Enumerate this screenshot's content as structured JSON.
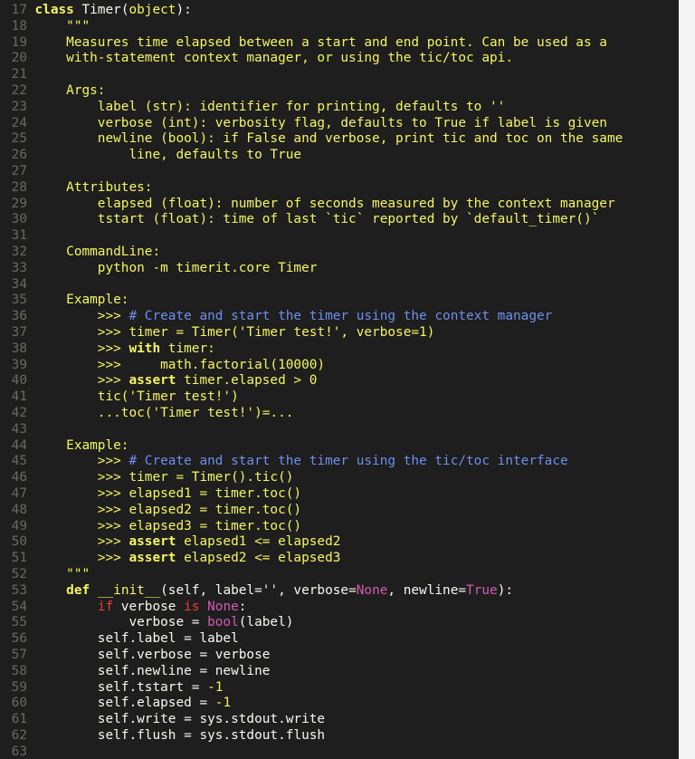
{
  "editor": {
    "lines": [
      {
        "n": "17",
        "tokens": [
          [
            "class ",
            "kw"
          ],
          [
            "Timer",
            "plain"
          ],
          [
            "(",
            "plain"
          ],
          [
            "object",
            "str"
          ],
          [
            "):",
            "plain"
          ]
        ]
      },
      {
        "n": "18",
        "tokens": [
          [
            "    \"\"\"",
            "str"
          ]
        ]
      },
      {
        "n": "19",
        "tokens": [
          [
            "    Measures time elapsed between a start and end point. Can be used as a",
            "str"
          ]
        ]
      },
      {
        "n": "20",
        "tokens": [
          [
            "    with-statement context manager, or using the tic/toc api.",
            "str"
          ]
        ]
      },
      {
        "n": "21",
        "tokens": []
      },
      {
        "n": "22",
        "tokens": [
          [
            "    Args:",
            "str"
          ]
        ]
      },
      {
        "n": "23",
        "tokens": [
          [
            "        label (str): identifier for printing, defaults to ''",
            "str"
          ]
        ]
      },
      {
        "n": "24",
        "tokens": [
          [
            "        verbose (int): verbosity flag, defaults to True if label is given",
            "str"
          ]
        ]
      },
      {
        "n": "25",
        "tokens": [
          [
            "        newline (bool): if False and verbose, print tic and toc on the same",
            "str"
          ]
        ]
      },
      {
        "n": "26",
        "tokens": [
          [
            "            line, defaults to True",
            "str"
          ]
        ]
      },
      {
        "n": "27",
        "tokens": []
      },
      {
        "n": "28",
        "tokens": [
          [
            "    Attributes:",
            "str"
          ]
        ]
      },
      {
        "n": "29",
        "tokens": [
          [
            "        elapsed (float): number of seconds measured by the context manager",
            "str"
          ]
        ]
      },
      {
        "n": "30",
        "tokens": [
          [
            "        tstart (float): time of last `tic` reported by `default_timer()`",
            "str"
          ]
        ]
      },
      {
        "n": "31",
        "tokens": []
      },
      {
        "n": "32",
        "tokens": [
          [
            "    CommandLine:",
            "str"
          ]
        ]
      },
      {
        "n": "33",
        "tokens": [
          [
            "        python -m timerit.core Timer",
            "str"
          ]
        ]
      },
      {
        "n": "34",
        "tokens": []
      },
      {
        "n": "35",
        "tokens": [
          [
            "    Example:",
            "str"
          ]
        ]
      },
      {
        "n": "36",
        "tokens": [
          [
            "        >>> ",
            "str"
          ],
          [
            "# Create and start the timer using the context manager",
            "cmt"
          ]
        ]
      },
      {
        "n": "37",
        "tokens": [
          [
            "        >>> timer = Timer('Timer test!', verbose=1)",
            "str"
          ]
        ]
      },
      {
        "n": "38",
        "tokens": [
          [
            "        >>> ",
            "str"
          ],
          [
            "with",
            "kw"
          ],
          [
            " timer:",
            "str"
          ]
        ]
      },
      {
        "n": "39",
        "tokens": [
          [
            "        >>>     math.factorial(10000)",
            "str"
          ]
        ]
      },
      {
        "n": "40",
        "tokens": [
          [
            "        >>> ",
            "str"
          ],
          [
            "assert",
            "kw"
          ],
          [
            " timer.elapsed > 0",
            "str"
          ]
        ]
      },
      {
        "n": "41",
        "tokens": [
          [
            "        tic('Timer test!')",
            "str"
          ]
        ]
      },
      {
        "n": "42",
        "tokens": [
          [
            "        ...toc('Timer test!')=...",
            "str"
          ]
        ]
      },
      {
        "n": "43",
        "tokens": []
      },
      {
        "n": "44",
        "tokens": [
          [
            "    Example:",
            "str"
          ]
        ]
      },
      {
        "n": "45",
        "tokens": [
          [
            "        >>> ",
            "str"
          ],
          [
            "# Create and start the timer using the tic/toc interface",
            "cmt"
          ]
        ]
      },
      {
        "n": "46",
        "tokens": [
          [
            "        >>> timer = Timer().tic()",
            "str"
          ]
        ]
      },
      {
        "n": "47",
        "tokens": [
          [
            "        >>> elapsed1 = timer.toc()",
            "str"
          ]
        ]
      },
      {
        "n": "48",
        "tokens": [
          [
            "        >>> elapsed2 = timer.toc()",
            "str"
          ]
        ]
      },
      {
        "n": "49",
        "tokens": [
          [
            "        >>> elapsed3 = timer.toc()",
            "str"
          ]
        ]
      },
      {
        "n": "50",
        "tokens": [
          [
            "        >>> ",
            "str"
          ],
          [
            "assert",
            "kw"
          ],
          [
            " elapsed1 <= elapsed2",
            "str"
          ]
        ]
      },
      {
        "n": "51",
        "tokens": [
          [
            "        >>> ",
            "str"
          ],
          [
            "assert",
            "kw"
          ],
          [
            " elapsed2 <= elapsed3",
            "str"
          ]
        ]
      },
      {
        "n": "52",
        "tokens": [
          [
            "    \"\"\"",
            "str"
          ]
        ]
      },
      {
        "n": "53",
        "tokens": [
          [
            "    ",
            "plain"
          ],
          [
            "def",
            "kw"
          ],
          [
            " ",
            "plain"
          ],
          [
            "__init__",
            "str"
          ],
          [
            "(self, label='', verbose=",
            "plain"
          ],
          [
            "None",
            "prm"
          ],
          [
            ", newline=",
            "plain"
          ],
          [
            "True",
            "prm"
          ],
          [
            "):",
            "plain"
          ]
        ]
      },
      {
        "n": "54",
        "tokens": [
          [
            "        ",
            "plain"
          ],
          [
            "if",
            "flow"
          ],
          [
            " verbose ",
            "plain"
          ],
          [
            "is",
            "flow"
          ],
          [
            " ",
            "plain"
          ],
          [
            "None",
            "prm"
          ],
          [
            ":",
            "plain"
          ]
        ]
      },
      {
        "n": "55",
        "tokens": [
          [
            "            verbose = ",
            "plain"
          ],
          [
            "bool",
            "prm"
          ],
          [
            "(label)",
            "plain"
          ]
        ]
      },
      {
        "n": "56",
        "tokens": [
          [
            "        self.label = label",
            "plain"
          ]
        ]
      },
      {
        "n": "57",
        "tokens": [
          [
            "        self.verbose = verbose",
            "plain"
          ]
        ]
      },
      {
        "n": "58",
        "tokens": [
          [
            "        self.newline = newline",
            "plain"
          ]
        ]
      },
      {
        "n": "59",
        "tokens": [
          [
            "        self.tstart = ",
            "plain"
          ],
          [
            "-1",
            "str"
          ]
        ]
      },
      {
        "n": "60",
        "tokens": [
          [
            "        self.elapsed = ",
            "plain"
          ],
          [
            "-1",
            "str"
          ]
        ]
      },
      {
        "n": "61",
        "tokens": [
          [
            "        self.write = sys.stdout.write",
            "plain"
          ]
        ]
      },
      {
        "n": "62",
        "tokens": [
          [
            "        self.flush = sys.stdout.flush",
            "plain"
          ]
        ]
      },
      {
        "n": "63",
        "tokens": []
      }
    ]
  }
}
